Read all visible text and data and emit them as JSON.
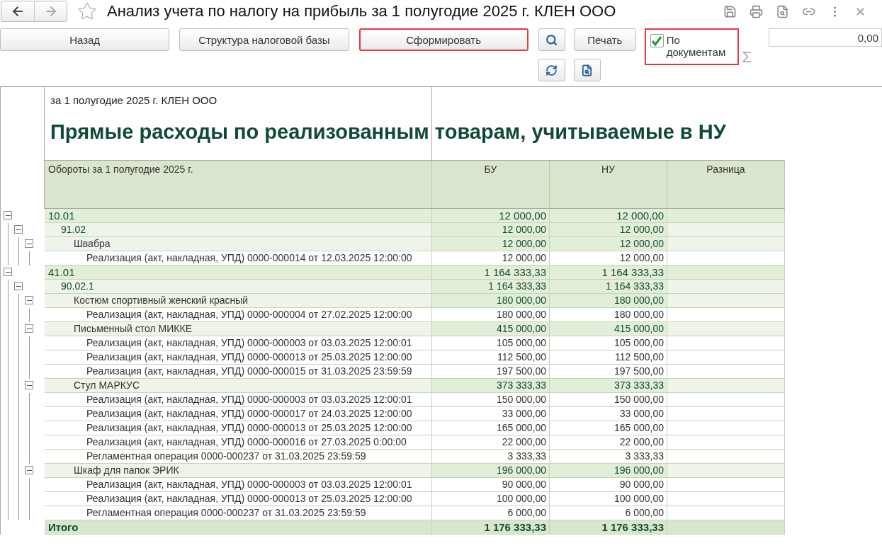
{
  "window": {
    "title": "Анализ учета по налогу на прибыль за 1 полугодие 2025 г. КЛЕН ООО",
    "favorite": false
  },
  "toolbar": {
    "buttons": [
      {
        "label": "Назад",
        "highlighted": false
      },
      {
        "label": "Структура налоговой базы",
        "highlighted": false
      },
      {
        "label": "Сформировать",
        "highlighted": true
      }
    ],
    "print_label": "Печать",
    "by_documents": {
      "label": "По документам",
      "checked": true,
      "highlighted": true
    },
    "sum_symbol": "Σ",
    "sum_value": "0,00"
  },
  "report": {
    "subtitle": "за 1 полугодие 2025 г. КЛЕН ООО",
    "title": "Прямые расходы по реализованным товарам, учитываемые в НУ",
    "columns": [
      "Обороты за 1 полугодие 2025 г.",
      "БУ",
      "НУ",
      "Разница"
    ],
    "rows": [
      {
        "label": "10.01",
        "bu": "12 000,00",
        "nu": "12 000,00",
        "expanded": true,
        "children": [
          {
            "label": "91.02",
            "bu": "12 000,00",
            "nu": "12 000,00",
            "expanded": true,
            "children": [
              {
                "label": "Швабра",
                "bu": "12 000,00",
                "nu": "12 000,00",
                "expanded": true,
                "children": [
                  {
                    "label": "Реализация (акт, накладная, УПД) 0000-000014 от 12.03.2025 12:00:00",
                    "bu": "12 000,00",
                    "nu": "12 000,00"
                  }
                ]
              }
            ]
          }
        ]
      },
      {
        "label": "41.01",
        "bu": "1 164 333,33",
        "nu": "1 164 333,33",
        "expanded": true,
        "children": [
          {
            "label": "90.02.1",
            "bu": "1 164 333,33",
            "nu": "1 164 333,33",
            "expanded": true,
            "children": [
              {
                "label": "Костюм спортивный женский красный",
                "bu": "180 000,00",
                "nu": "180 000,00",
                "expanded": true,
                "children": [
                  {
                    "label": "Реализация (акт, накладная, УПД) 0000-000004 от 27.02.2025 12:00:00",
                    "bu": "180 000,00",
                    "nu": "180 000,00"
                  }
                ]
              },
              {
                "label": "Письменный стол МИККЕ",
                "bu": "415 000,00",
                "nu": "415 000,00",
                "expanded": true,
                "children": [
                  {
                    "label": "Реализация (акт, накладная, УПД) 0000-000003 от 03.03.2025 12:00:01",
                    "bu": "105 000,00",
                    "nu": "105 000,00"
                  },
                  {
                    "label": "Реализация (акт, накладная, УПД) 0000-000013 от 25.03.2025 12:00:00",
                    "bu": "112 500,00",
                    "nu": "112 500,00"
                  },
                  {
                    "label": "Реализация (акт, накладная, УПД) 0000-000015 от 31.03.2025 23:59:59",
                    "bu": "197 500,00",
                    "nu": "197 500,00"
                  }
                ]
              },
              {
                "label": "Стул МАРКУС",
                "bu": "373 333,33",
                "nu": "373 333,33",
                "expanded": true,
                "children": [
                  {
                    "label": "Реализация (акт, накладная, УПД) 0000-000003 от 03.03.2025 12:00:01",
                    "bu": "150 000,00",
                    "nu": "150 000,00"
                  },
                  {
                    "label": "Реализация (акт, накладная, УПД) 0000-000017 от 24.03.2025 12:00:00",
                    "bu": "33 000,00",
                    "nu": "33 000,00"
                  },
                  {
                    "label": "Реализация (акт, накладная, УПД) 0000-000013 от 25.03.2025 12:00:00",
                    "bu": "165 000,00",
                    "nu": "165 000,00"
                  },
                  {
                    "label": "Реализация (акт, накладная, УПД) 0000-000016 от 27.03.2025 0:00:00",
                    "bu": "22 000,00",
                    "nu": "22 000,00"
                  },
                  {
                    "label": "Регламентная операция 0000-000237 от 31.03.2025 23:59:59",
                    "bu": "3 333,33",
                    "nu": "3 333,33"
                  }
                ]
              },
              {
                "label": "Шкаф для папок ЭРИК",
                "bu": "196 000,00",
                "nu": "196 000,00",
                "expanded": true,
                "children": [
                  {
                    "label": "Реализация (акт, накладная, УПД) 0000-000003 от 03.03.2025 12:00:01",
                    "bu": "90 000,00",
                    "nu": "90 000,00"
                  },
                  {
                    "label": "Реализация (акт, накладная, УПД) 0000-000013 от 25.03.2025 12:00:00",
                    "bu": "100 000,00",
                    "nu": "100 000,00"
                  },
                  {
                    "label": "Регламентная операция 0000-000237 от 31.03.2025 23:59:59",
                    "bu": "6 000,00",
                    "nu": "6 000,00"
                  }
                ]
              }
            ]
          }
        ]
      }
    ],
    "total": {
      "label": "Итого",
      "bu": "1 176 333,33",
      "nu": "1 176 333,33"
    }
  }
}
